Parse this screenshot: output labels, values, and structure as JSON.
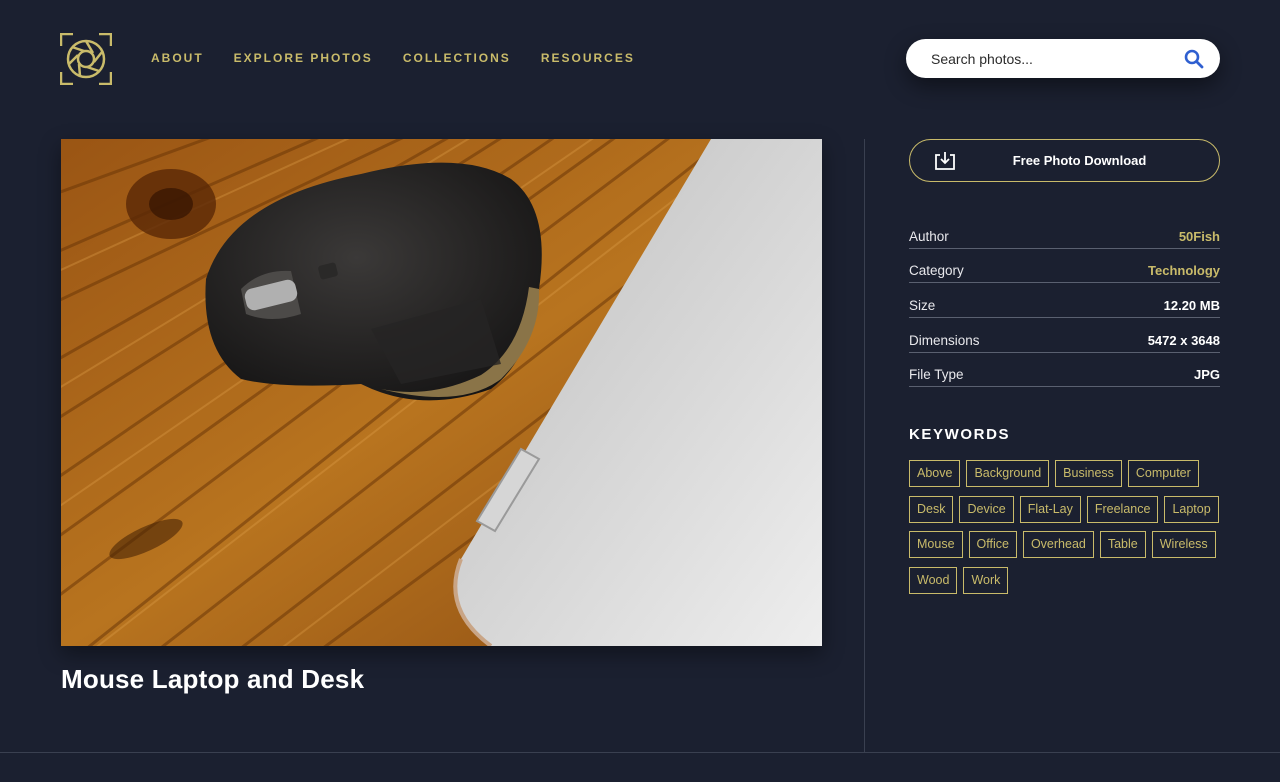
{
  "colors": {
    "background": "#1b2030",
    "accent": "#c9bb6a",
    "text": "#ffffff",
    "divider": "#3a4050"
  },
  "header": {
    "logo_icon": "aperture-logo-icon",
    "nav": [
      "ABOUT",
      "EXPLORE PHOTOS",
      "COLLECTIONS",
      "RESOURCES"
    ],
    "search": {
      "placeholder": "Search photos...",
      "icon": "search-icon"
    }
  },
  "photo": {
    "title": "Mouse Laptop and Desk",
    "description_icon": "photo-mouse-laptop-desk"
  },
  "sidebar": {
    "download": {
      "label": "Free Photo Download",
      "icon": "download-icon"
    },
    "details": [
      {
        "key": "Author",
        "value": "50Fish",
        "accent": true
      },
      {
        "key": "Category",
        "value": "Technology",
        "accent": true
      },
      {
        "key": "Size",
        "value": "12.20 MB",
        "accent": false
      },
      {
        "key": "Dimensions",
        "value": "5472 x 3648",
        "accent": false
      },
      {
        "key": "File Type",
        "value": "JPG",
        "accent": false
      }
    ],
    "keywords_heading": "KEYWORDS",
    "keywords": [
      "Above",
      "Background",
      "Business",
      "Computer",
      "Desk",
      "Device",
      "Flat-Lay",
      "Freelance",
      "Laptop",
      "Mouse",
      "Office",
      "Overhead",
      "Table",
      "Wireless",
      "Wood",
      "Work"
    ]
  }
}
